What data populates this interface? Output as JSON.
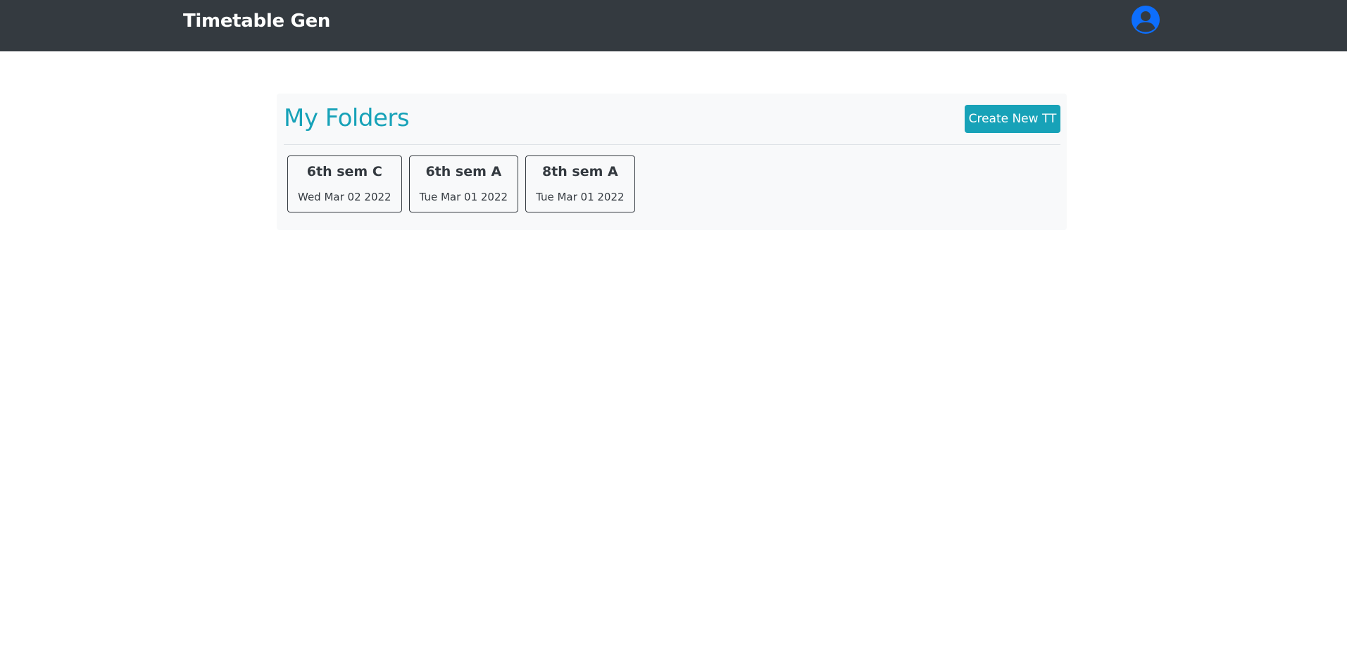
{
  "navbar": {
    "brand": "Timetable Gen",
    "avatar_icon": "user-circle-icon",
    "avatar_color": "#0d6efd",
    "background": "#343a40"
  },
  "folders_panel": {
    "title": "My Folders",
    "create_button_label": "Create New TT",
    "accent_color": "#17a2b8",
    "items": [
      {
        "name": "6th sem C",
        "date": "Wed Mar 02 2022"
      },
      {
        "name": "6th sem A",
        "date": "Tue Mar 01 2022"
      },
      {
        "name": "8th sem A",
        "date": "Tue Mar 01 2022"
      }
    ]
  }
}
